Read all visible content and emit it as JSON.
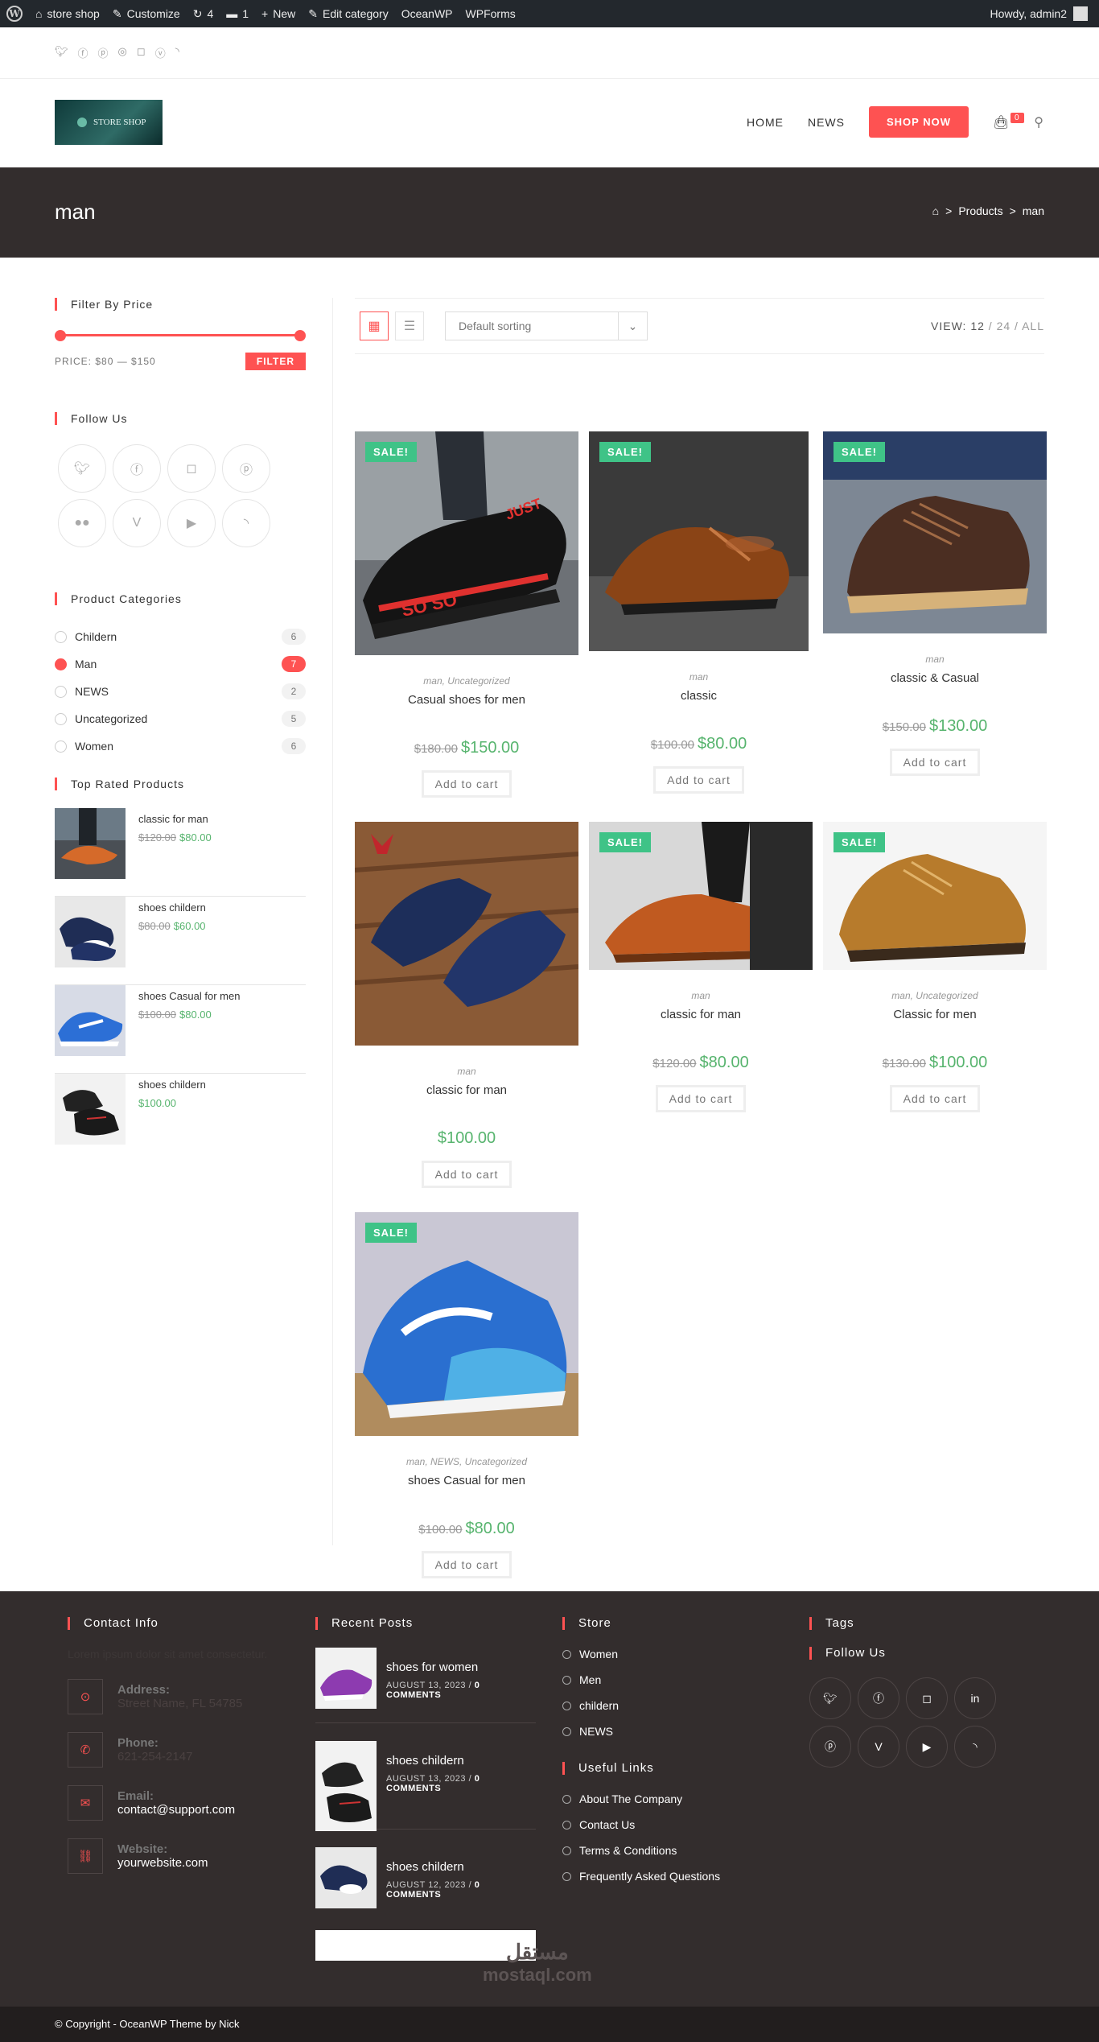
{
  "adminbar": {
    "site": "store shop",
    "customize": "Customize",
    "updates": "4",
    "comments": "1",
    "new": "New",
    "edit": "Edit category",
    "oceanwp": "OceanWP",
    "wpforms": "WPForms",
    "howdy": "Howdy, admin2"
  },
  "topbar": {
    "social_icons": [
      "twitter-icon",
      "facebook-icon",
      "pinterest-icon",
      "dribbble-icon",
      "instagram-icon",
      "vimeo-icon",
      "rss-icon"
    ]
  },
  "header": {
    "logo_text": "STORE SHOP",
    "nav": [
      "HOME",
      "NEWS"
    ],
    "shop_now": "SHOP NOW",
    "cart_count": "0"
  },
  "titlebar": {
    "title": "man",
    "breadcrumb": [
      "Products",
      "man"
    ]
  },
  "sidebar": {
    "filter_title": "Filter By Price",
    "price_label": "PRICE: $80 — $150",
    "filter_button": "FILTER",
    "follow_title": "Follow Us",
    "categories_title": "Product Categories",
    "categories": [
      {
        "name": "Childern",
        "count": "6",
        "active": false
      },
      {
        "name": "Man",
        "count": "7",
        "active": true
      },
      {
        "name": "NEWS",
        "count": "2",
        "active": false
      },
      {
        "name": "Uncategorized",
        "count": "5",
        "active": false
      },
      {
        "name": "Women",
        "count": "6",
        "active": false
      }
    ],
    "top_rated_title": "Top Rated Products",
    "top_rated": [
      {
        "name": "classic for man",
        "old": "$120.00",
        "new": "$80.00"
      },
      {
        "name": "shoes childern",
        "old": "$80.00",
        "new": "$60.00"
      },
      {
        "name": "shoes Casual for men",
        "old": "$100.00",
        "new": "$80.00"
      },
      {
        "name": "shoes childern",
        "old": "",
        "new": "$100.00"
      }
    ]
  },
  "toolbar": {
    "sort": "Default sorting",
    "view_label": "VIEW:",
    "view_12": "12",
    "view_24": "24",
    "view_all": "ALL"
  },
  "products": [
    {
      "sale": "SALE!",
      "cats": "man, Uncategorized",
      "title": "Casual shoes for men",
      "old": "$180.00",
      "new": "$150.00",
      "cta": "Add to cart"
    },
    {
      "sale": "SALE!",
      "cats": "man",
      "title": "classic",
      "old": "$100.00",
      "new": "$80.00",
      "cta": "Add to cart"
    },
    {
      "sale": "SALE!",
      "cats": "man",
      "title": "classic & Casual",
      "old": "$150.00",
      "new": "$130.00",
      "cta": "Add to cart"
    },
    {
      "sale": "",
      "cats": "man",
      "title": "classic for man",
      "old": "",
      "new": "$100.00",
      "cta": "Add to cart"
    },
    {
      "sale": "SALE!",
      "cats": "man",
      "title": "classic for man",
      "old": "$120.00",
      "new": "$80.00",
      "cta": "Add to cart"
    },
    {
      "sale": "SALE!",
      "cats": "man, Uncategorized",
      "title": "Classic for men",
      "old": "$130.00",
      "new": "$100.00",
      "cta": "Add to cart"
    },
    {
      "sale": "SALE!",
      "cats": "man, NEWS, Uncategorized",
      "title": "shoes Casual for men",
      "old": "$100.00",
      "new": "$80.00",
      "cta": "Add to cart"
    }
  ],
  "footer": {
    "contact_title": "Contact Info",
    "lorem": "Lorem ipsum dolor sit amet consectetur.",
    "address_label": "Address:",
    "address_val": "Street Name, FL 54785",
    "phone_label": "Phone:",
    "phone_val": "621-254-2147",
    "email_label": "Email:",
    "email_val": "contact@support.com",
    "website_label": "Website:",
    "website_val": "yourwebsite.com",
    "posts_title": "Recent Posts",
    "posts": [
      {
        "title": "shoes for women",
        "date": "AUGUST 13, 2023",
        "comments": "0 COMMENTS"
      },
      {
        "title": "shoes childern",
        "date": "AUGUST 13, 2023",
        "comments": "0 COMMENTS"
      },
      {
        "title": "shoes childern",
        "date": "AUGUST 12, 2023",
        "comments": "0 COMMENTS"
      }
    ],
    "store_title": "Store",
    "store_links": [
      "Women",
      "Men",
      "childern",
      "NEWS"
    ],
    "useful_title": "Useful Links",
    "useful_links": [
      "About The Company",
      "Contact Us",
      "Terms & Conditions",
      "Frequently Asked Questions"
    ],
    "tags_title": "Tags",
    "follow_title": "Follow Us",
    "watermark": "مستقل",
    "watermark_sub": "mostaql.com",
    "copyright": "© Copyright - OceanWP Theme by Nick"
  },
  "colors": {
    "accent": "#fe5252",
    "sale": "#3fc387",
    "price": "#57b46e",
    "dark": "#332d2d"
  }
}
